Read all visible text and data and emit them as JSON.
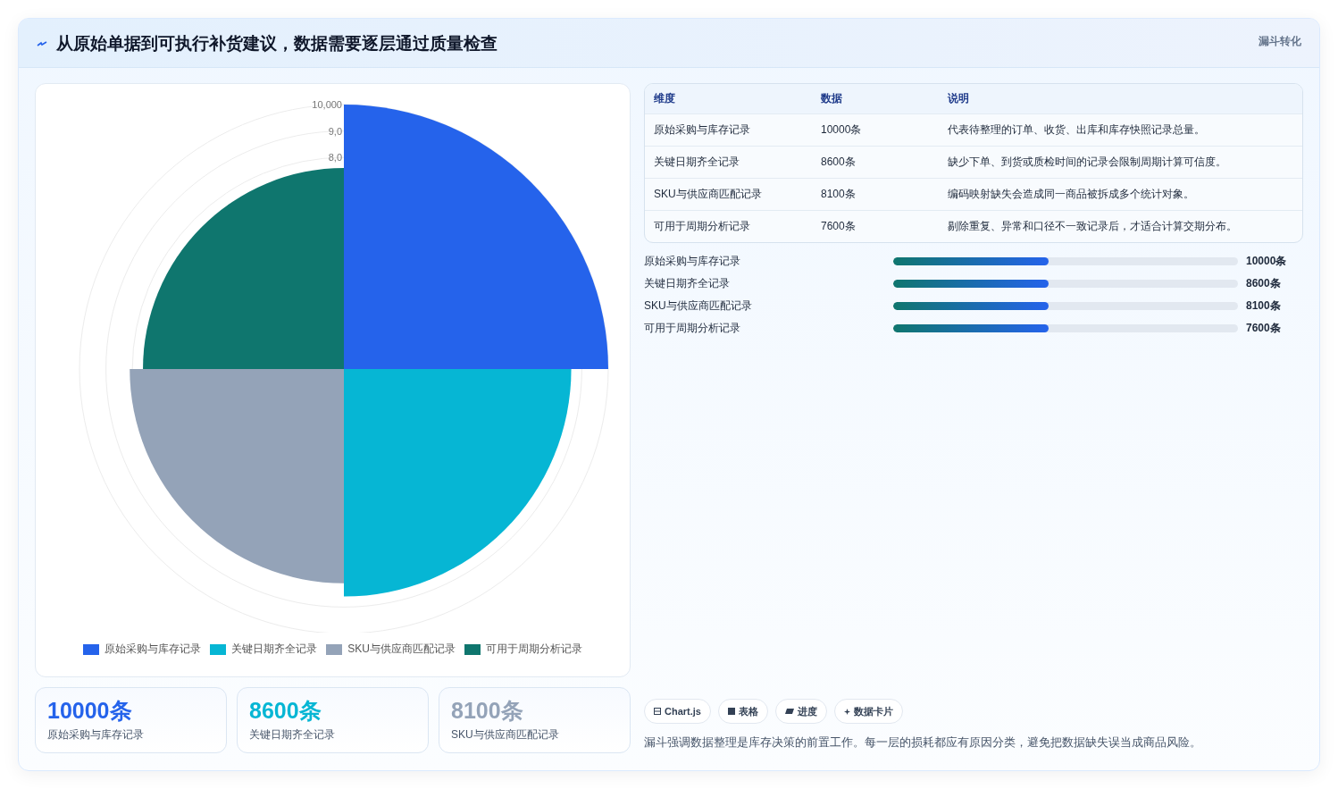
{
  "header": {
    "title": "从原始单据到可执行补货建议，数据需要逐层通过质量检查",
    "tag": "漏斗转化"
  },
  "chart": {
    "ticks": [
      "10,000",
      "9,0",
      "8,0"
    ],
    "segments": [
      {
        "color": "#2563eb",
        "level": 1.0
      },
      {
        "color": "#06b6d4",
        "level": 0.86
      },
      {
        "color": "#94a3b8",
        "level": 0.81
      },
      {
        "color": "#0f766e",
        "level": 0.76
      }
    ],
    "legend": [
      {
        "label": "原始采购与库存记录",
        "color": "#2563eb"
      },
      {
        "label": "关键日期齐全记录",
        "color": "#06b6d4"
      },
      {
        "label": "SKU与供应商匹配记录",
        "color": "#94a3b8"
      },
      {
        "label": "可用于周期分析记录",
        "color": "#0f766e"
      }
    ]
  },
  "stats": [
    {
      "value": "10000条",
      "label": "原始采购与库存记录",
      "color": "#2563eb"
    },
    {
      "value": "8600条",
      "label": "关键日期齐全记录",
      "color": "#06b6d4"
    },
    {
      "value": "8100条",
      "label": "SKU与供应商匹配记录",
      "color": "#94a3b8"
    }
  ],
  "table": {
    "columns": [
      "维度",
      "数据",
      "说明"
    ],
    "rows": [
      [
        "原始采购与库存记录",
        "10000条",
        "代表待整理的订单、收货、出库和库存快照记录总量。"
      ],
      [
        "关键日期齐全记录",
        "8600条",
        "缺少下单、到货或质检时间的记录会限制周期计算可信度。"
      ],
      [
        "SKU与供应商匹配记录",
        "8100条",
        "编码映射缺失会造成同一商品被拆成多个统计对象。"
      ],
      [
        "可用于周期分析记录",
        "7600条",
        "剔除重复、异常和口径不一致记录后，才适合计算交期分布。"
      ]
    ]
  },
  "bars": [
    {
      "label": "原始采购与库存记录",
      "level": 0.45,
      "reading": "10000条"
    },
    {
      "label": "关键日期齐全记录",
      "level": 0.45,
      "reading": "8600条"
    },
    {
      "label": "SKU与供应商匹配记录",
      "level": 0.45,
      "reading": "8100条"
    },
    {
      "label": "可用于周期分析记录",
      "level": 0.45,
      "reading": "7600条"
    }
  ],
  "pills": [
    {
      "kind": "chart",
      "label": "Chart.js"
    },
    {
      "kind": "table",
      "label": "表格"
    },
    {
      "kind": "progress",
      "label": "进度"
    },
    {
      "kind": "card",
      "label": "数据卡片"
    }
  ],
  "note": "漏斗强调数据整理是库存决策的前置工作。每一层的损耗都应有原因分类，避免把数据缺失误当成商品风险。"
}
